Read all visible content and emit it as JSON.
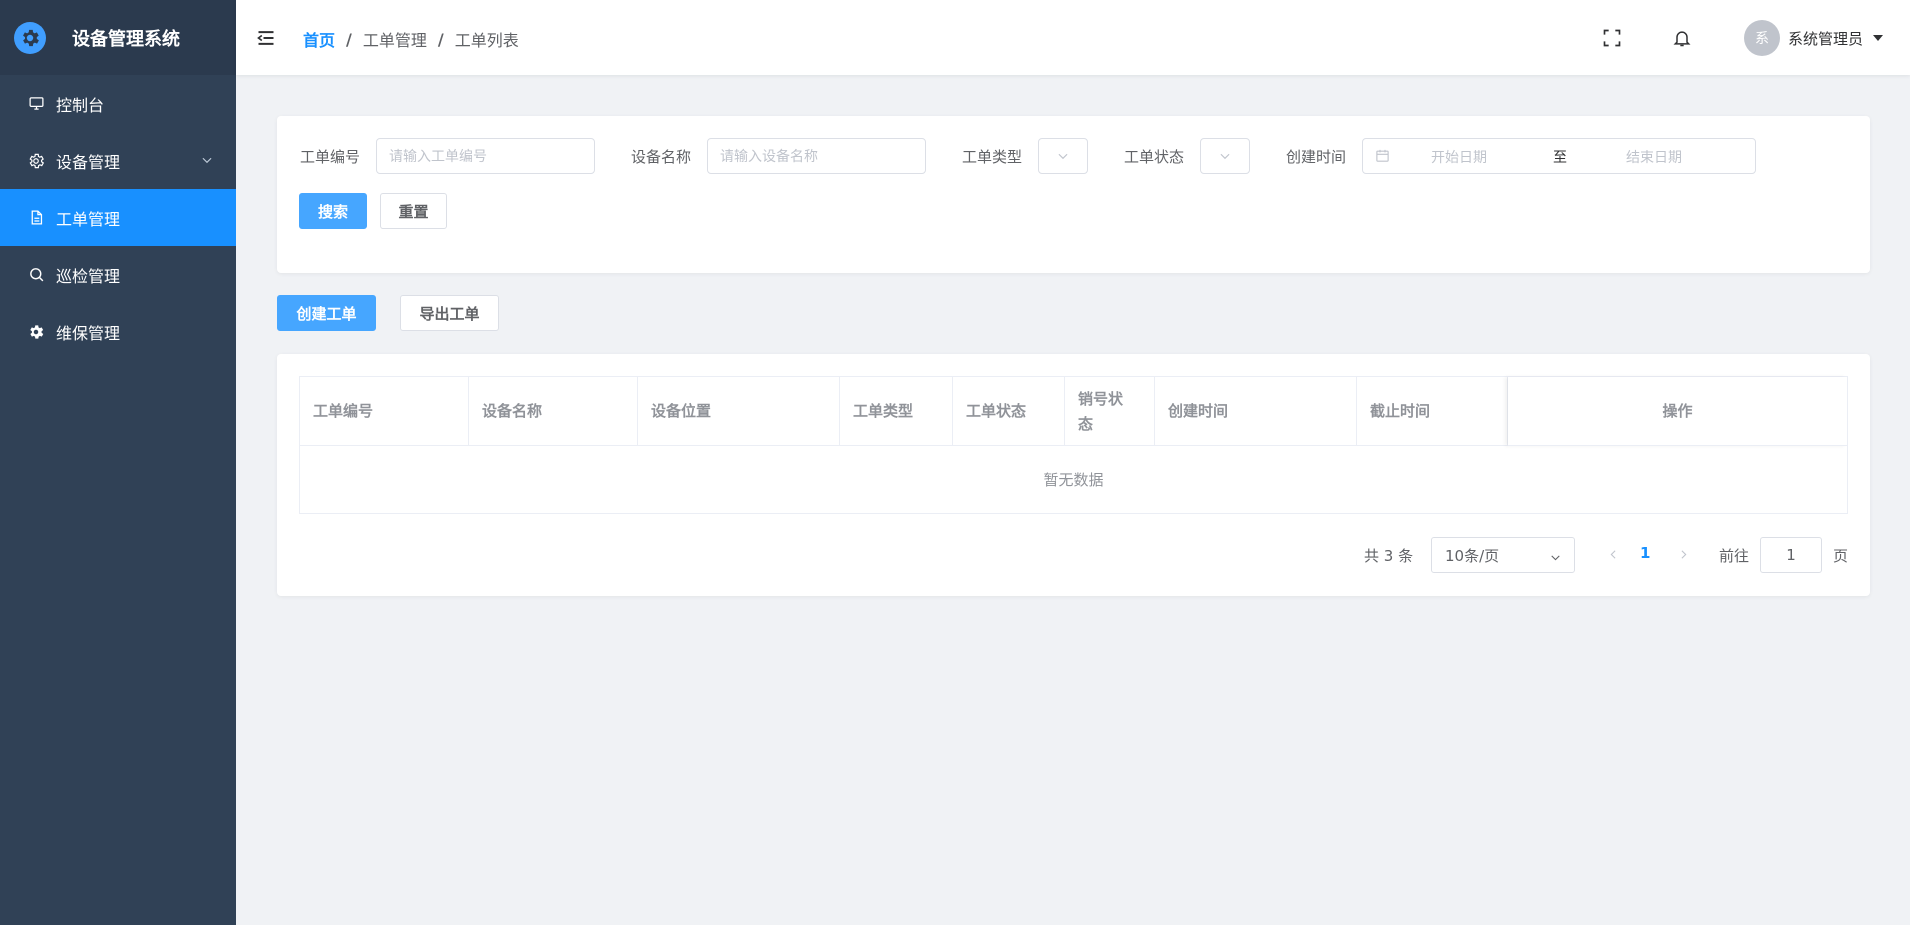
{
  "app": {
    "title": "设备管理系统"
  },
  "sidebar": {
    "items": [
      {
        "label": "控制台",
        "icon": "monitor-icon"
      },
      {
        "label": "设备管理",
        "icon": "gear-outline-icon"
      },
      {
        "label": "工单管理",
        "icon": "document-icon"
      },
      {
        "label": "巡检管理",
        "icon": "search-icon"
      },
      {
        "label": "维保管理",
        "icon": "gear-solid-icon"
      }
    ],
    "active_index": 2
  },
  "header": {
    "breadcrumb": [
      "首页",
      "工单管理",
      "工单列表"
    ],
    "separator": "/",
    "user": {
      "avatar_text": "系",
      "name": "系统管理员"
    }
  },
  "search": {
    "order_no": {
      "label": "工单编号",
      "placeholder": "请输入工单编号"
    },
    "device_name": {
      "label": "设备名称",
      "placeholder": "请输入设备名称"
    },
    "order_type": {
      "label": "工单类型"
    },
    "order_status": {
      "label": "工单状态"
    },
    "created_time": {
      "label": "创建时间",
      "start_placeholder": "开始日期",
      "separator": "至",
      "end_placeholder": "结束日期"
    },
    "search_button": "搜索",
    "reset_button": "重置"
  },
  "actions": {
    "create_button": "创建工单",
    "export_button": "导出工单"
  },
  "table": {
    "columns": [
      "工单编号",
      "设备名称",
      "设备位置",
      "工单类型",
      "工单状态",
      "销号状态",
      "创建时间",
      "截止时间",
      "操作"
    ],
    "empty_text": "暂无数据"
  },
  "pagination": {
    "total_text": "共 3 条",
    "page_size": "10条/页",
    "current_page": "1",
    "goto_label": "前往",
    "goto_value": "1",
    "page_suffix": "页"
  },
  "colors": {
    "sidebar_bg": "#304156",
    "accent": "#1890ff",
    "primary_button": "#46a6ff",
    "page_bg": "#f0f2f5"
  }
}
